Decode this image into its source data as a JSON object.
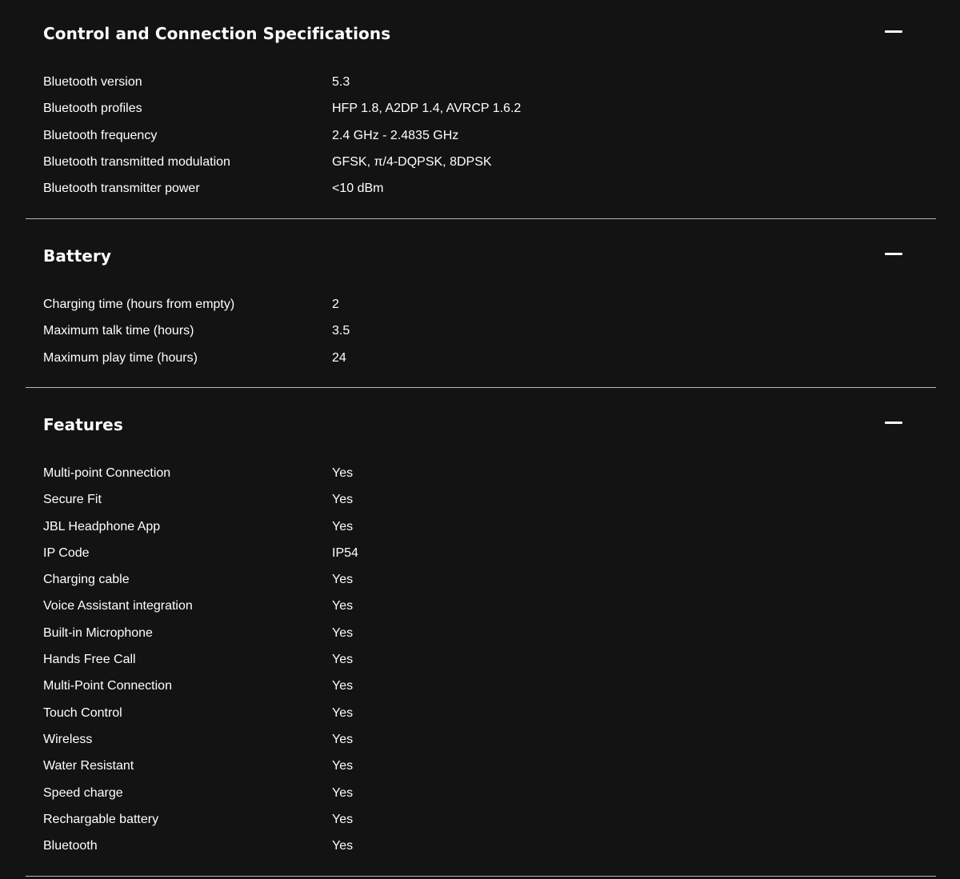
{
  "sections": [
    {
      "title": "Control and Connection Specifications",
      "toggle_icon": "minus-icon",
      "rows": [
        {
          "label": "Bluetooth version",
          "value": "5.3"
        },
        {
          "label": "Bluetooth profiles",
          "value": "HFP 1.8, A2DP 1.4, AVRCP 1.6.2"
        },
        {
          "label": "Bluetooth frequency",
          "value": "2.4 GHz - 2.4835 GHz"
        },
        {
          "label": "Bluetooth transmitted modulation",
          "value": "GFSK, π/4-DQPSK, 8DPSK"
        },
        {
          "label": "Bluetooth transmitter power",
          "value": "<10 dBm"
        }
      ]
    },
    {
      "title": "Battery",
      "toggle_icon": "minus-icon",
      "rows": [
        {
          "label": "Charging time (hours from empty)",
          "value": "2"
        },
        {
          "label": "Maximum talk time (hours)",
          "value": "3.5"
        },
        {
          "label": "Maximum play time (hours)",
          "value": "24"
        }
      ]
    },
    {
      "title": "Features",
      "toggle_icon": "minus-icon",
      "rows": [
        {
          "label": "Multi-point Connection",
          "value": "Yes"
        },
        {
          "label": "Secure Fit",
          "value": "Yes"
        },
        {
          "label": "JBL Headphone App",
          "value": "Yes"
        },
        {
          "label": "IP Code",
          "value": "IP54"
        },
        {
          "label": "Charging cable",
          "value": "Yes"
        },
        {
          "label": "Voice Assistant integration",
          "value": "Yes"
        },
        {
          "label": "Built-in Microphone",
          "value": "Yes"
        },
        {
          "label": "Hands Free Call",
          "value": "Yes"
        },
        {
          "label": "Multi-Point Connection",
          "value": "Yes"
        },
        {
          "label": "Touch Control",
          "value": "Yes"
        },
        {
          "label": "Wireless",
          "value": "Yes"
        },
        {
          "label": "Water Resistant",
          "value": "Yes"
        },
        {
          "label": "Speed charge",
          "value": "Yes"
        },
        {
          "label": "Rechargable battery",
          "value": "Yes"
        },
        {
          "label": "Bluetooth",
          "value": "Yes"
        }
      ]
    }
  ],
  "colors": {
    "background": "#131313",
    "text": "#ffffff",
    "divider": "#b9b9b9"
  }
}
